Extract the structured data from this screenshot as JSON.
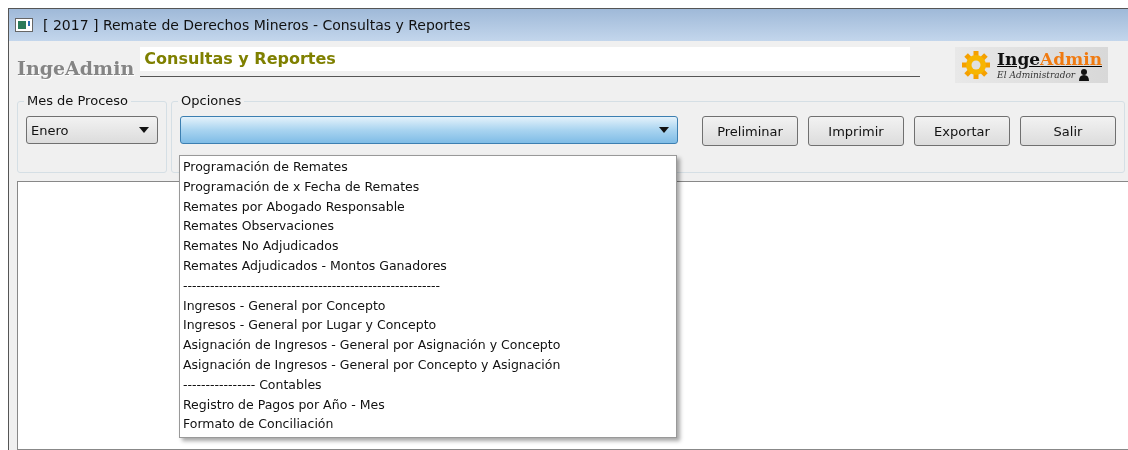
{
  "window": {
    "title": "[ 2017 ] Remate de Derechos Mineros - Consultas y Reportes"
  },
  "header": {
    "app_name": "IngeAdmin",
    "section_title": "Consultas y Reportes",
    "logo": {
      "name_part_1": "Inge",
      "name_part_2": "Admin",
      "tagline": "El Administrador"
    }
  },
  "month": {
    "label": "Mes de Proceso",
    "value": "Enero"
  },
  "options": {
    "label": "Opciones",
    "expanded": true,
    "items": [
      "Programación de Remates",
      "Programación de x Fecha de Remates",
      "Remates por Abogado Responsable",
      "Remates Observaciones",
      "Remates No Adjudicados",
      "Remates Adjudicados - Montos Ganadores",
      "---------------------------------------------------------",
      "Ingresos - General por Concepto",
      "Ingresos - General por Lugar y Concepto",
      "Asignación de Ingresos - General por Asignación y Concepto",
      "Asignación de Ingresos - General por Concepto y Asignación",
      "---------------- Contables",
      "Registro de Pagos por Año - Mes",
      "Formato de Conciliación"
    ]
  },
  "buttons": [
    "Preliminar",
    "Imprimir",
    "Exportar",
    "Salir"
  ]
}
